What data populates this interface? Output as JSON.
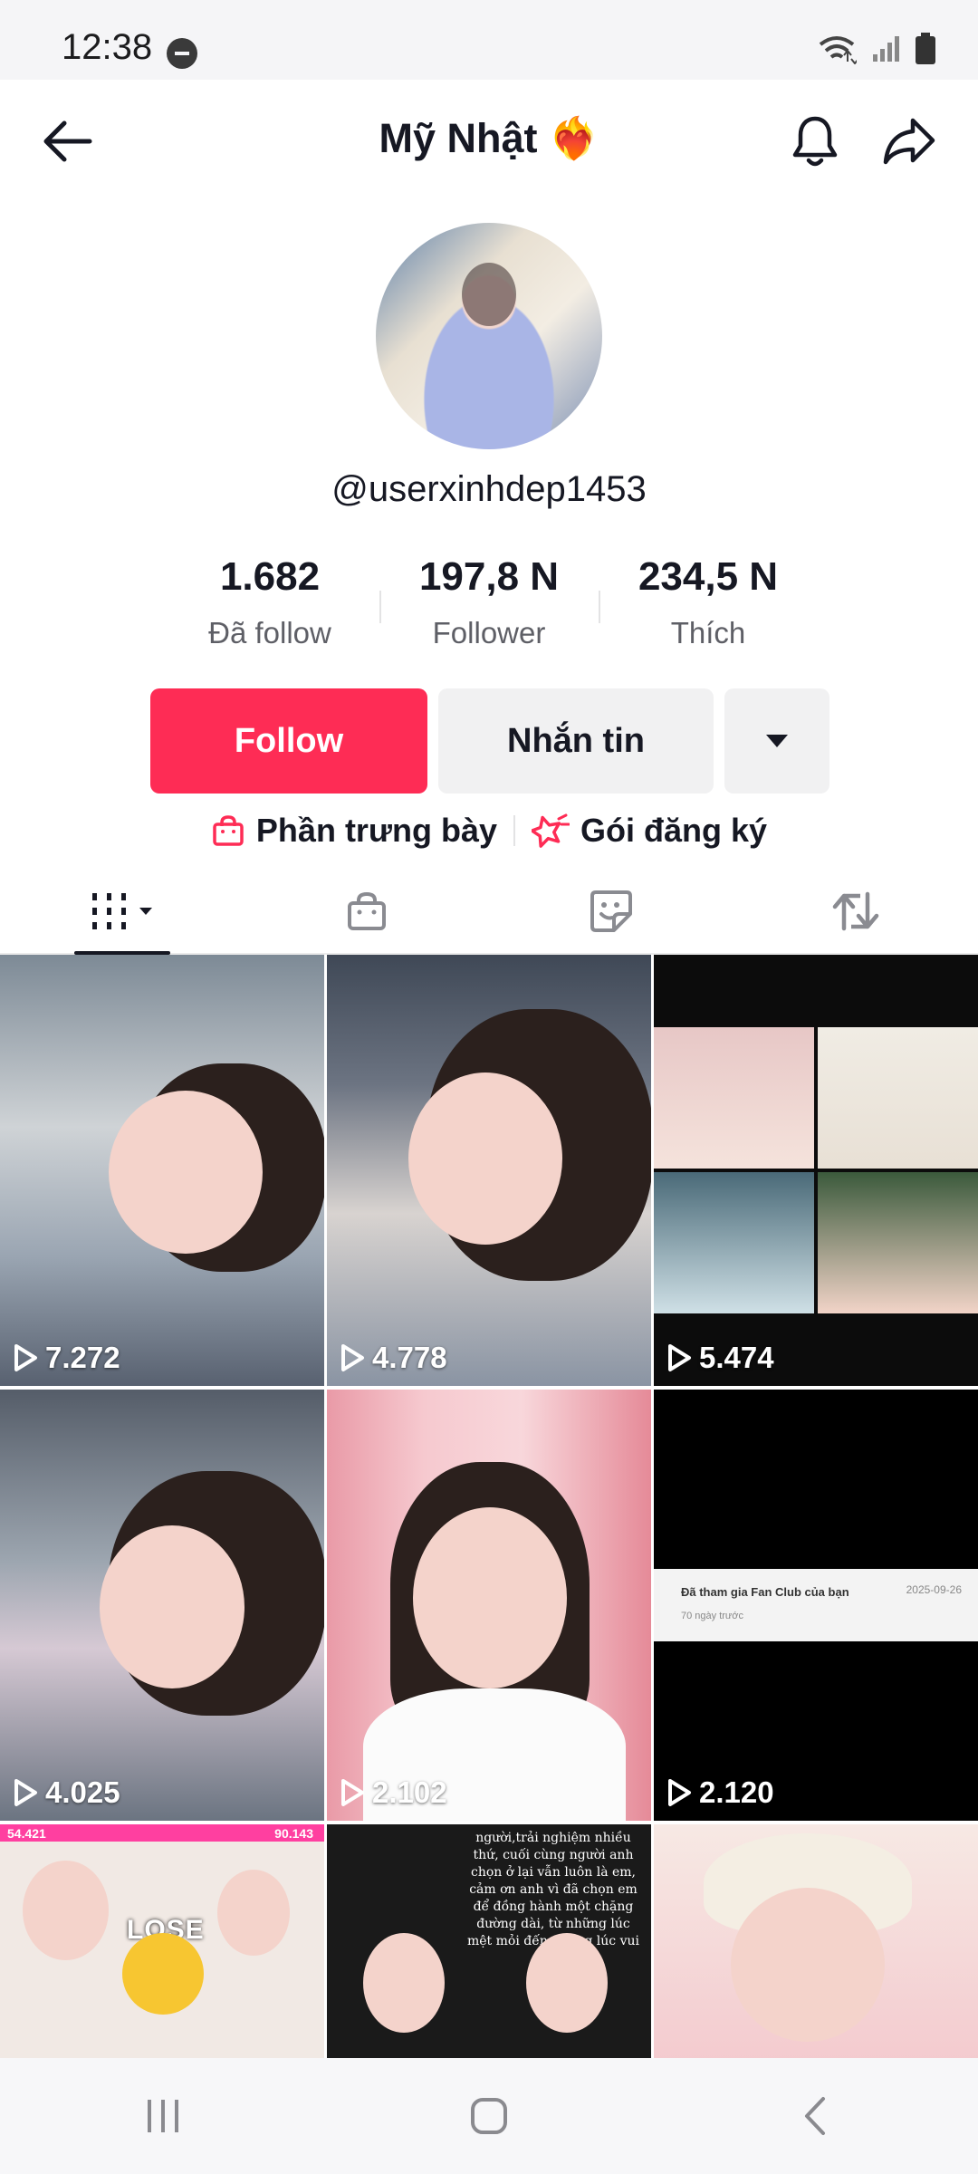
{
  "status_bar": {
    "time": "12:38"
  },
  "header": {
    "title": "Mỹ Nhật",
    "title_emoji": "❤️‍🔥"
  },
  "profile": {
    "username": "@userxinhdep1453"
  },
  "stats": [
    {
      "value": "1.682",
      "label": "Đã follow"
    },
    {
      "value": "197,8 N",
      "label": "Follower"
    },
    {
      "value": "234,5 N",
      "label": "Thích"
    }
  ],
  "actions": {
    "follow_label": "Follow",
    "message_label": "Nhắn tin"
  },
  "links": {
    "showcase_label": "Phần trưng bày",
    "subscription_label": "Gói đăng ký"
  },
  "videos": [
    {
      "views": "7.272"
    },
    {
      "views": "4.778"
    },
    {
      "views": "5.474"
    },
    {
      "views": "4.025"
    },
    {
      "views": "2.102"
    },
    {
      "views": "2.120"
    }
  ],
  "tile6_card": {
    "text": "Đã tham gia Fan Club của bạn",
    "date": "2025-09-26",
    "ago": "70 ngày trước"
  },
  "tile7_overlay": {
    "score_left": "54.421",
    "score_right": "90.143",
    "text": "LOSE"
  },
  "tile8_caption": "người,trải nghiệm nhiều thứ, cuối cùng người anh chọn ở lại vẫn luôn là em, cảm ơn anh vì đã chọn em để đồng hành một chặng đường dài, từ những lúc mệt mỏi đến những lúc vui vẻ",
  "colors": {
    "accent": "#fe2c55",
    "text": "#161823",
    "secondary_bg": "#f1f1f2"
  },
  "icons": [
    "back-arrow-icon",
    "bell-icon",
    "share-icon",
    "caret-down-icon",
    "shopping-bag-icon",
    "star-badge-icon",
    "grid-icon",
    "shop-icon",
    "sticker-icon",
    "repost-icon",
    "play-icon",
    "recent-apps-icon",
    "home-icon",
    "back-icon",
    "wifi-icon",
    "signal-icon",
    "battery-icon"
  ]
}
